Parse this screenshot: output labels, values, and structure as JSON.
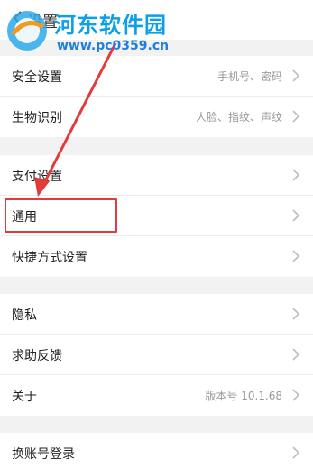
{
  "header": {
    "title": "设置"
  },
  "watermark": {
    "title": "河东软件园",
    "url": "www.pc0359.cn"
  },
  "groups": [
    {
      "items": [
        {
          "label": "安全设置",
          "value": "手机号、密码"
        },
        {
          "label": "生物识别",
          "value": "人脸、指纹、声纹"
        }
      ]
    },
    {
      "items": [
        {
          "label": "支付设置",
          "value": ""
        },
        {
          "label": "通用",
          "value": ""
        },
        {
          "label": "快捷方式设置",
          "value": ""
        }
      ]
    },
    {
      "items": [
        {
          "label": "隐私",
          "value": ""
        },
        {
          "label": "求助反馈",
          "value": ""
        },
        {
          "label": "关于",
          "value": "版本号 10.1.68"
        }
      ]
    },
    {
      "items": [
        {
          "label": "换账号登录",
          "value": ""
        }
      ]
    }
  ],
  "colors": {
    "accent": "#e23b3b",
    "watermark": "#0ea0e6"
  },
  "icons": {
    "back": "back-arrow-icon",
    "row": "chevron-right-icon"
  }
}
